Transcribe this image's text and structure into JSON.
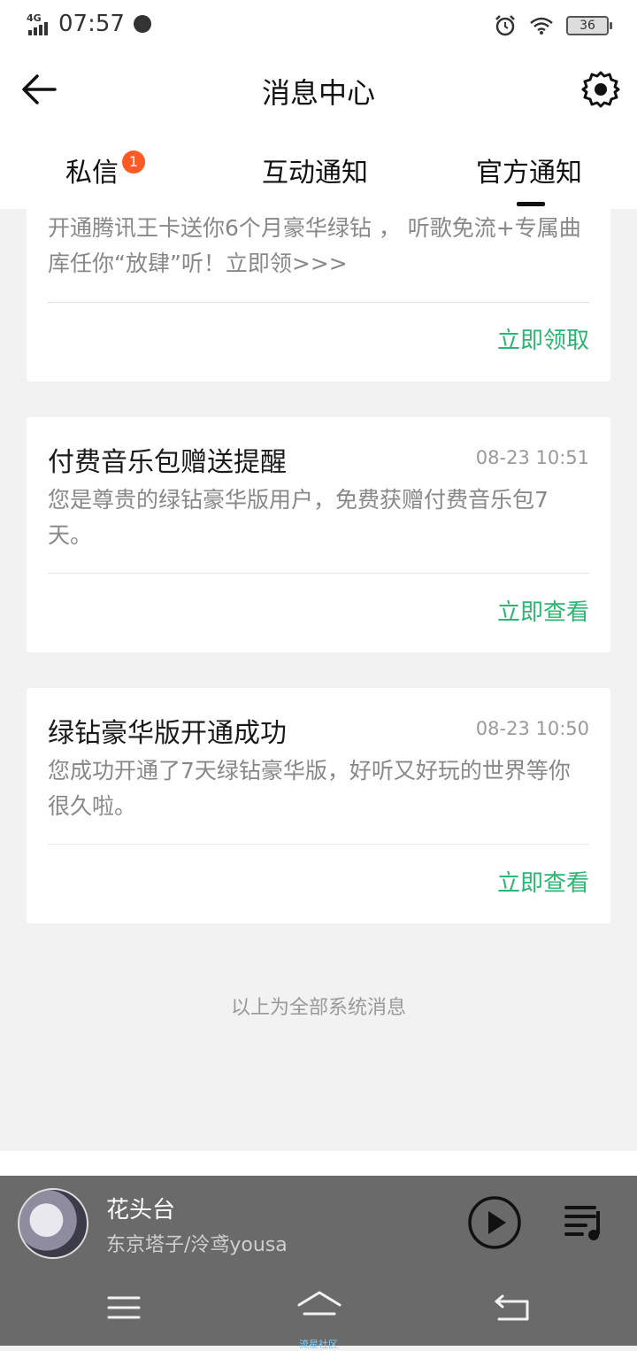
{
  "status_bar": {
    "network": "4G",
    "time": "07:57",
    "battery": "36"
  },
  "header": {
    "title": "消息中心"
  },
  "tabs": [
    {
      "label": "私信",
      "badge": "1"
    },
    {
      "label": "互动通知"
    },
    {
      "label": "官方通知",
      "active": true
    }
  ],
  "messages": [
    {
      "title": "",
      "time": "",
      "body": "开通腾讯王卡送你6个月豪华绿钻 ， 听歌免流+专属曲库任你“放肆”听！立即领>>>",
      "action": "立即领取"
    },
    {
      "title": "付费音乐包赠送提醒",
      "time": "08-23 10:51",
      "body": "您是尊贵的绿钻豪华版用户，免费获赠付费音乐包7天。",
      "action": "立即查看"
    },
    {
      "title": "绿钻豪华版开通成功",
      "time": "08-23 10:50",
      "body": "您成功开通了7天绿钻豪华版，好听又好玩的世界等你很久啦。",
      "action": "立即查看"
    }
  ],
  "end_note": "以上为全部系统消息",
  "player": {
    "song_title": "花头台",
    "artist": "东京塔子/泠鸢yousa"
  },
  "nav": {
    "home_label": "流星社区"
  },
  "colors": {
    "accent_green": "#2bb673",
    "badge": "#ff5a24",
    "player_bg": "#6a6a6a"
  }
}
